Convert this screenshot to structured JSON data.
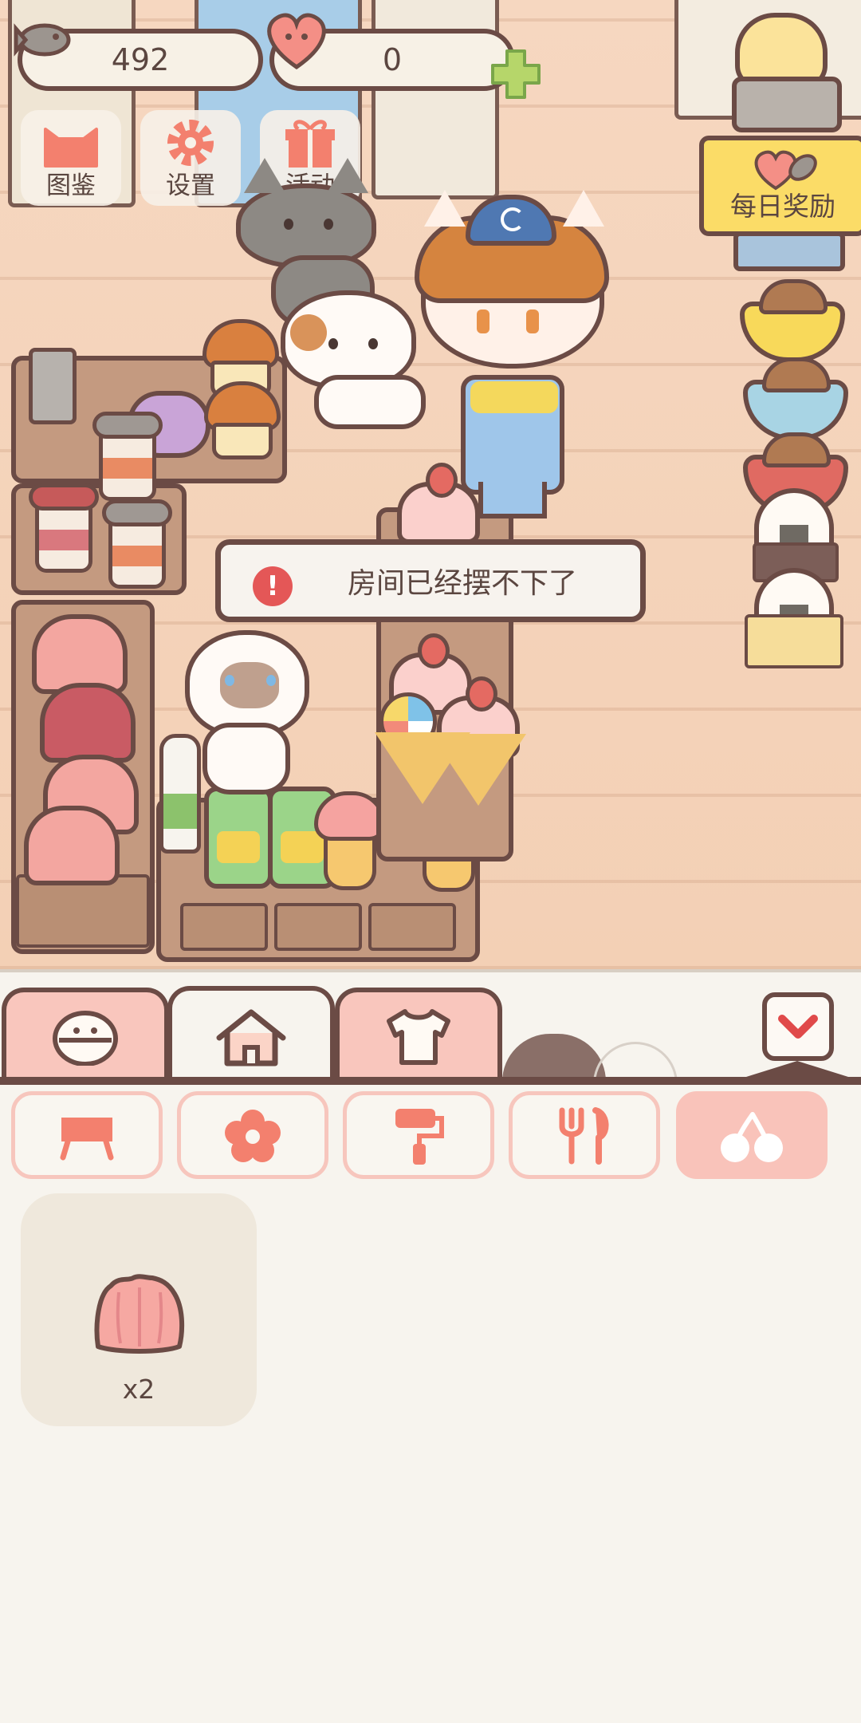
{
  "hud": {
    "fish_count": "492",
    "heart_count": "0",
    "buttons": [
      {
        "label": "图鉴",
        "icon": "cat-face-icon"
      },
      {
        "label": "设置",
        "icon": "gear-icon"
      },
      {
        "label": "活动",
        "icon": "gift-icon"
      }
    ],
    "daily_reward": "每日奖励"
  },
  "toast": {
    "message": "房间已经摆不下了",
    "icon": "warning-icon"
  },
  "inventory": {
    "category_tabs": [
      {
        "icon": "cat-bed-icon",
        "active": false
      },
      {
        "icon": "house-icon",
        "active": true
      },
      {
        "icon": "shirt-icon",
        "active": false
      }
    ],
    "sub_tabs": [
      {
        "icon": "table-icon",
        "active": false
      },
      {
        "icon": "flower-icon",
        "active": false
      },
      {
        "icon": "paint-roller-icon",
        "active": false
      },
      {
        "icon": "cutlery-icon",
        "active": false
      },
      {
        "icon": "cherry-icon",
        "active": true
      }
    ],
    "items": [
      {
        "icon": "jelly-pudding-icon",
        "quantity": "x2"
      }
    ]
  },
  "colors": {
    "outline": "#6b4b45",
    "accent_pink": "#f9c3ba",
    "banner_yellow": "#fbdc67",
    "panel_bg": "#f7f4ee",
    "floor": "#f4d3b9"
  }
}
